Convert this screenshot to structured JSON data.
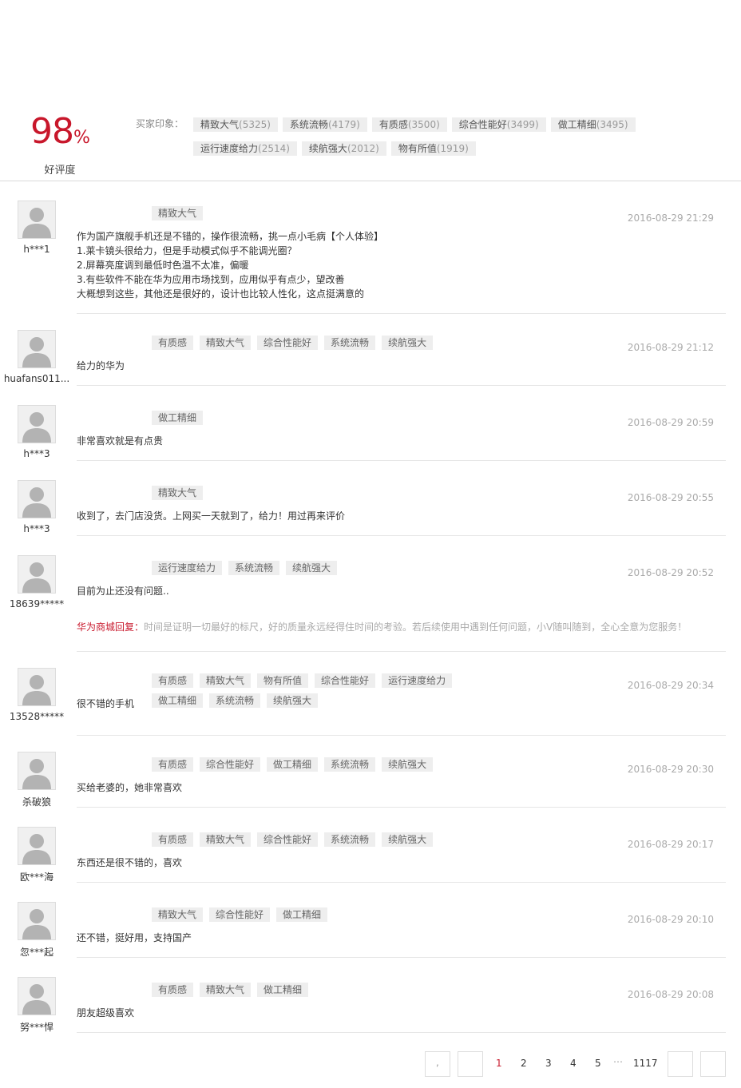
{
  "summary": {
    "rate_value": "98",
    "rate_unit": "%",
    "rate_label": "好评度",
    "impression_title": "买家印象：",
    "impressions": [
      {
        "label": "精致大气",
        "count": "(5325)"
      },
      {
        "label": "系统流畅",
        "count": "(4179)"
      },
      {
        "label": "有质感",
        "count": "(3500)"
      },
      {
        "label": "综合性能好",
        "count": "(3499)"
      },
      {
        "label": "做工精细",
        "count": "(3495)"
      },
      {
        "label": "运行速度给力",
        "count": "(2514)"
      },
      {
        "label": "续航强大",
        "count": "(2012)"
      },
      {
        "label": "物有所值",
        "count": "(1919)"
      }
    ]
  },
  "reviews": [
    {
      "user": "h***1",
      "tags": [
        "精致大气"
      ],
      "date": "2016-08-29 21:29",
      "content": [
        "作为国产旗舰手机还是不错的，操作很流畅，挑一点小毛病【个人体验】",
        "1.莱卡镜头很给力，但是手动模式似乎不能调光圈？",
        "2.屏幕亮度调到最低时色温不太准，偏暖",
        "3.有些软件不能在华为应用市场找到，应用似乎有点少，望改善",
        "大概想到这些，其他还是很好的，设计也比较人性化，这点挺满意的"
      ]
    },
    {
      "user": "huafans011...",
      "tags": [
        "有质感",
        "精致大气",
        "综合性能好",
        "系统流畅",
        "续航强大"
      ],
      "date": "2016-08-29 21:12",
      "content": [
        "给力的华为"
      ]
    },
    {
      "user": "h***3",
      "tags": [
        "做工精细"
      ],
      "date": "2016-08-29 20:59",
      "content": [
        "非常喜欢就是有点贵"
      ]
    },
    {
      "user": "h***3",
      "tags": [
        "精致大气"
      ],
      "date": "2016-08-29 20:55",
      "content": [
        "收到了，去门店没货。上网买一天就到了，给力！用过再来评价"
      ]
    },
    {
      "user": "18639*****",
      "tags": [
        "运行速度给力",
        "系统流畅",
        "续航强大"
      ],
      "date": "2016-08-29 20:52",
      "content": [
        "目前为止还没有问题.."
      ],
      "reply_who": "华为商城回复：",
      "reply_text": "时间是证明一切最好的标尺，好的质量永远经得住时间的考验。若后续使用中遇到任何问题，小V随叫随到，全心全意为您服务！"
    },
    {
      "user": "13528*****",
      "tags": [
        "有质感",
        "精致大气",
        "物有所值",
        "综合性能好",
        "运行速度给力",
        "做工精细",
        "系统流畅",
        "续航强大"
      ],
      "date": "2016-08-29 20:34",
      "content": [
        "很不错的手机"
      ]
    },
    {
      "user": "杀破狼",
      "tags": [
        "有质感",
        "综合性能好",
        "做工精细",
        "系统流畅",
        "续航强大"
      ],
      "date": "2016-08-29 20:30",
      "content": [
        "买给老婆的，她非常喜欢"
      ]
    },
    {
      "user": "欧***海",
      "tags": [
        "有质感",
        "精致大气",
        "综合性能好",
        "系统流畅",
        "续航强大"
      ],
      "date": "2016-08-29 20:17",
      "content": [
        "东西还是很不错的，喜欢"
      ]
    },
    {
      "user": "忽***起",
      "tags": [
        "精致大气",
        "综合性能好",
        "做工精细"
      ],
      "date": "2016-08-29 20:10",
      "content": [
        "还不错，挺好用，支持国产"
      ]
    },
    {
      "user": "努***悍",
      "tags": [
        "有质感",
        "精致大气",
        "做工精细"
      ],
      "date": "2016-08-29 20:08",
      "content": [
        "朋友超级喜欢"
      ]
    }
  ],
  "pager": {
    "first_label": ",",
    "pages": [
      "1",
      "2",
      "3",
      "4",
      "5"
    ],
    "ellipsis": "…",
    "last_page": "1117",
    "current": "1"
  }
}
